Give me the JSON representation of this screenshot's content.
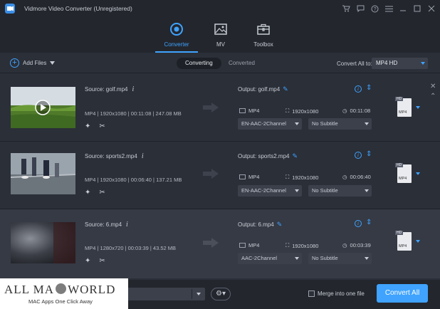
{
  "app": {
    "title": "Vidmore Video Converter (Unregistered)"
  },
  "window_controls": [
    "cart-icon",
    "chat-icon",
    "help-icon",
    "menu-icon",
    "minimize-icon",
    "maximize-icon",
    "close-icon"
  ],
  "main_tabs": [
    {
      "label": "Converter",
      "icon": "converter-icon",
      "active": true
    },
    {
      "label": "MV",
      "icon": "mv-icon",
      "active": false
    },
    {
      "label": "Toolbox",
      "icon": "toolbox-icon",
      "active": false
    }
  ],
  "toolbar": {
    "add_files_label": "Add Files",
    "converting_label": "Converting",
    "converted_label": "Converted",
    "convert_all_to_label": "Convert All to:",
    "convert_all_to_value": "MP4 HD"
  },
  "files": [
    {
      "source": "Source: golf.mp4",
      "meta": "MP4 | 1920x1080 | 00:11:08 | 247.08 MB",
      "output": "Output: golf.mp4",
      "out_format": "MP4",
      "out_resolution": "1920x1080",
      "out_duration": "00:11:08",
      "audio": "EN-AAC-2Channel",
      "subtitle": "No Subtitle",
      "format_badge": "MP4",
      "hd": "HD"
    },
    {
      "source": "Source: sports2.mp4",
      "meta": "MP4 | 1920x1080 | 00:06:40 | 137.21 MB",
      "output": "Output: sports2.mp4",
      "out_format": "MP4",
      "out_resolution": "1920x1080",
      "out_duration": "00:06:40",
      "audio": "EN-AAC-2Channel",
      "subtitle": "No Subtitle",
      "format_badge": "MP4",
      "hd": "HD"
    },
    {
      "source": "Source: 6.mp4",
      "meta": "MP4 | 1280x720 | 00:03:39 | 43.52 MB",
      "output": "Output: 6.mp4",
      "out_format": "MP4",
      "out_resolution": "1920x1080",
      "out_duration": "00:03:39",
      "audio": "AAC-2Channel",
      "subtitle": "No Subtitle",
      "format_badge": "MP4",
      "hd": "HD"
    }
  ],
  "bottom": {
    "merge_label": "Merge into one file",
    "convert_all_button": "Convert All"
  },
  "watermark": {
    "left": "ALL MA",
    "right": "WORLD",
    "subtitle": "MAC Apps One Click Away"
  },
  "colors": {
    "accent": "#3fa3ff",
    "background": "#2b2f38",
    "titlebar": "#23262d"
  }
}
